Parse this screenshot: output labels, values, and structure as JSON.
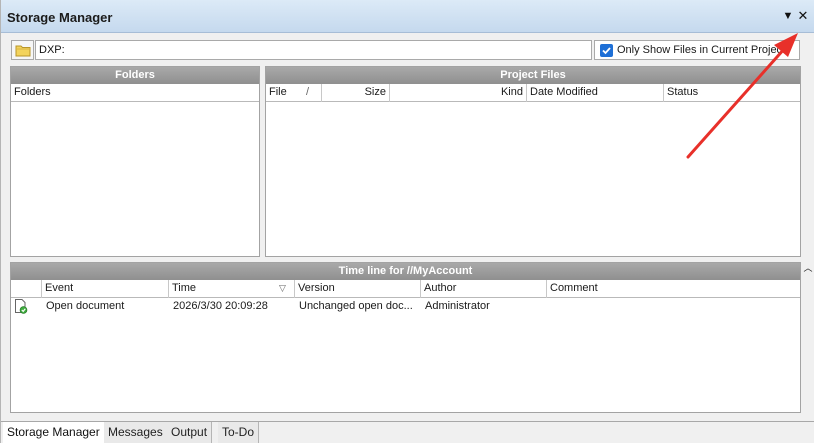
{
  "window": {
    "title": "Storage Manager",
    "dropdown_glyph": "▼",
    "close_glyph": "✕"
  },
  "pathbar": {
    "path_value": "DXP:",
    "only_show_label": "Only Show Files in Current Project",
    "only_show_checked": true
  },
  "folders": {
    "header": "Folders",
    "column": "Folders"
  },
  "project_files": {
    "header": "Project Files",
    "columns": {
      "file": "File",
      "size": "Size",
      "kind": "Kind",
      "date_modified": "Date Modified",
      "status": "Status"
    },
    "sort_indicator": "/"
  },
  "timeline": {
    "header": "Time line for //MyAccount",
    "columns": {
      "event": "Event",
      "time": "Time",
      "version": "Version",
      "author": "Author",
      "comment": "Comment"
    },
    "time_sort_indicator": "▽",
    "rows": [
      {
        "event": "Open document",
        "time": "2026/3/30 20:09:28",
        "version": "Unchanged open doc...",
        "author": "Administrator",
        "comment": ""
      }
    ]
  },
  "tabs": [
    {
      "label": "Storage Manager",
      "active": true
    },
    {
      "label": "Messages",
      "active": false
    },
    {
      "label": "Output",
      "active": false
    },
    {
      "label": "To-Do",
      "active": false
    }
  ],
  "colors": {
    "titlebar": "#c5d9ee",
    "panel_header": "#9a9a9a",
    "checkbox": "#1e6fd6",
    "annotation_arrow": "#e8302a"
  }
}
